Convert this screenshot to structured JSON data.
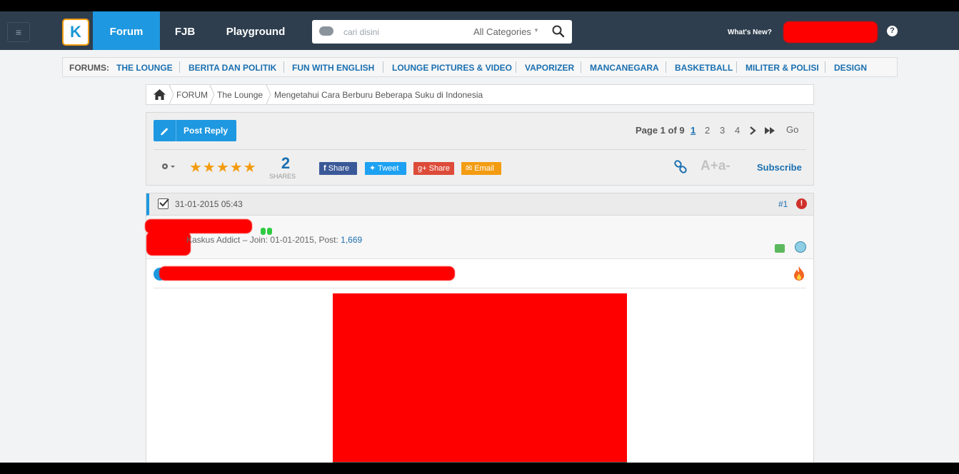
{
  "nav": {
    "menu_icon": "hamburger-icon",
    "logo_text": "K",
    "tabs": [
      {
        "label": "Forum",
        "active": true
      },
      {
        "label": "FJB",
        "active": false
      },
      {
        "label": "Playground",
        "active": false
      }
    ],
    "search": {
      "placeholder": "cari disini",
      "category": "All Categories"
    },
    "whats_new": "What's New?",
    "help_icon": "?"
  },
  "forums": {
    "label": "FORUMS:",
    "links": [
      "THE LOUNGE",
      "BERITA DAN POLITIK",
      "FUN WITH ENGLISH",
      "LOUNGE PICTURES & VIDEO",
      "VAPORIZER",
      "MANCANEGARA",
      "BASKETBALL",
      "MILITER & POLISI",
      "DESIGN"
    ]
  },
  "breadcrumb": {
    "items": [
      "FORUM",
      "The Lounge",
      "Mengetahui Cara Berburu Beberapa Suku di Indonesia"
    ]
  },
  "toolbar": {
    "post_reply": "Post Reply",
    "page_label": "Page 1 of 9",
    "pages": [
      "1",
      "2",
      "3",
      "4"
    ],
    "go": "Go",
    "rating": 5,
    "stars": "★★★★★",
    "shares_count": "2",
    "shares_label": "SHARES",
    "share_buttons": [
      {
        "label": "Share",
        "network": "facebook",
        "color": "#3b5998"
      },
      {
        "label": "Tweet",
        "network": "twitter",
        "color": "#1da1f2"
      },
      {
        "label": "Share",
        "network": "google-plus",
        "color": "#dd4b39"
      },
      {
        "label": "Email",
        "network": "email",
        "color": "#f39c12"
      }
    ],
    "subscribe": "Subscribe",
    "font_size_icon": "A+a-"
  },
  "post": {
    "date": "31-01-2015 05:43",
    "number": "#1",
    "user_rank": "Kaskus Addict",
    "join_label": "Join: 01-01-2015",
    "post_label": "Post:",
    "post_count": "1,669",
    "hot_icon": "fire-icon"
  },
  "colors": {
    "nav_bg": "#2e3e4e",
    "accent": "#1e98e0",
    "link": "#1a6fb0",
    "star": "#f39c12",
    "redaction": "#ff0000"
  }
}
